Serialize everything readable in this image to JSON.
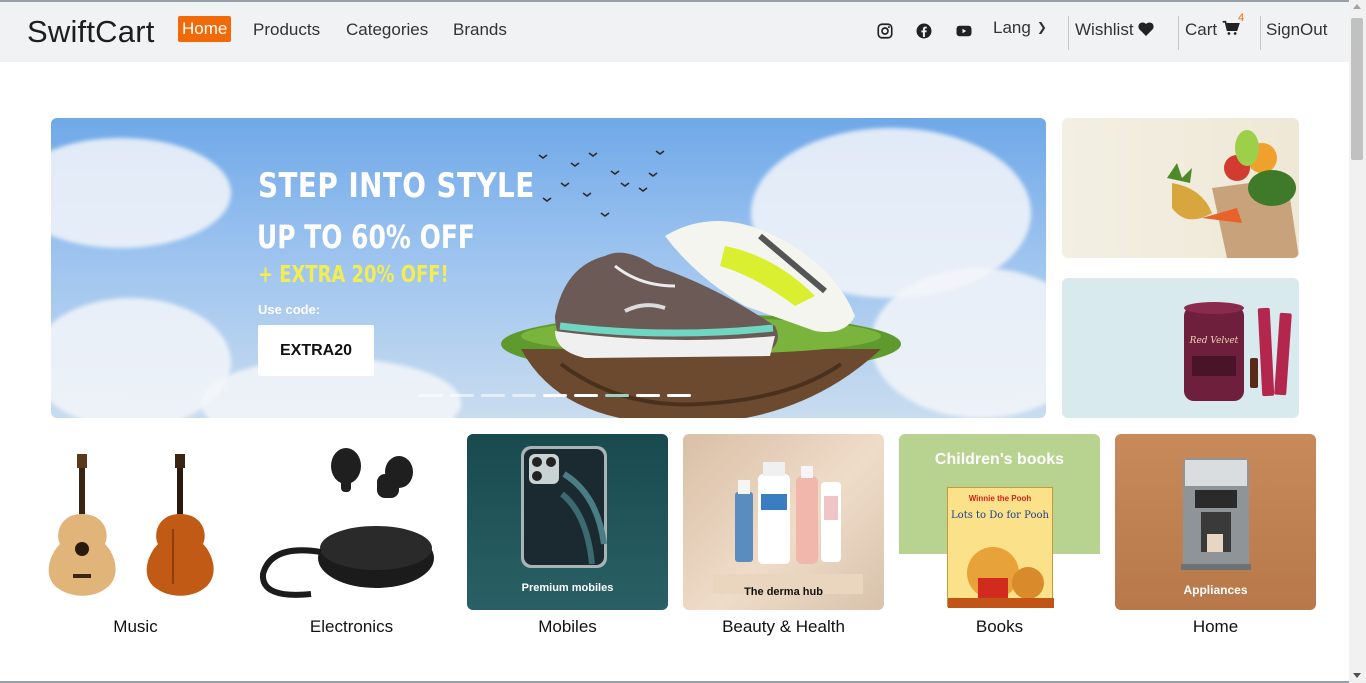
{
  "brand": "SwiftCart",
  "nav": {
    "items": [
      {
        "label": "Home",
        "active": true
      },
      {
        "label": "Products",
        "active": false
      },
      {
        "label": "Categories",
        "active": false
      },
      {
        "label": "Brands",
        "active": false
      }
    ],
    "social_icons": [
      "instagram-icon",
      "facebook-icon",
      "youtube-icon"
    ],
    "lang_label": "Lang",
    "wishlist_label": "Wishlist",
    "cart_label": "Cart",
    "cart_count": "4",
    "signout_label": "SignOut"
  },
  "hero": {
    "title": "STEP INTO STYLE",
    "subtitle": "UP TO 60% OFF",
    "extra": "+ EXTRA 20% OFF!",
    "use_code_label": "Use code:",
    "code": "EXTRA20",
    "slide_count": 9,
    "active_slide": 7
  },
  "categories": [
    {
      "label": "Music",
      "overlay": ""
    },
    {
      "label": "Electronics",
      "overlay": ""
    },
    {
      "label": "Mobiles",
      "overlay": "Premium mobiles"
    },
    {
      "label": "Beauty & Health",
      "overlay": "The derma hub"
    },
    {
      "label": "Books",
      "overlay": "Children's books",
      "book_title": "Lots to Do for Pooh",
      "book_series": "Winnie the Pooh"
    },
    {
      "label": "Home",
      "overlay": "Appliances"
    }
  ],
  "colors": {
    "accent": "#f26a07",
    "navbar_bg": "#f1f2f4",
    "extra_text": "#f2ee52"
  }
}
